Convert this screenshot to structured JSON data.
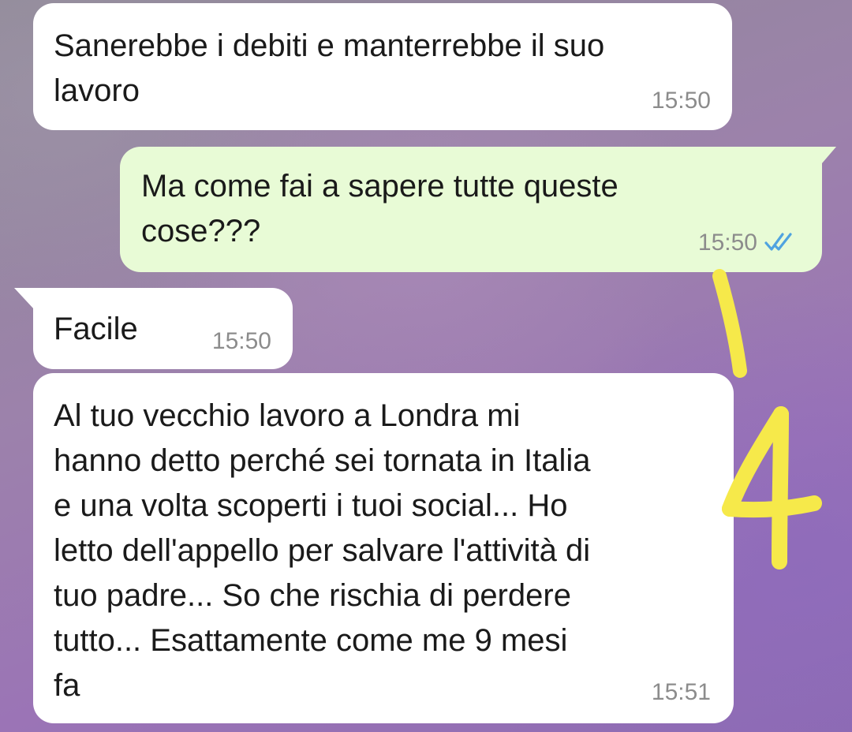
{
  "messages": [
    {
      "direction": "incoming",
      "text": "Sanerebbe i debiti e manterrebbe il suo\nlavoro",
      "time": "15:50"
    },
    {
      "direction": "outgoing",
      "text": "Ma come fai a sapere tutte queste\ncose???",
      "time": "15:50",
      "status_icon": "double-check-read-icon"
    },
    {
      "direction": "incoming",
      "text": "Facile",
      "time": "15:50"
    },
    {
      "direction": "incoming",
      "text": "Al tuo vecchio lavoro a Londra mi\nhanno detto perché sei tornata in Italia\ne una volta scoperti i tuoi social... Ho\nletto dell'appello per salvare l'attività di\ntuo padre... So che rischia di perdere\ntutto... Esattamente come me 9 mesi\nfa",
      "time": "15:51"
    }
  ],
  "annotation": {
    "icon": "handwritten-number-annotation",
    "color": "#f6e94a",
    "label": "4"
  },
  "colors": {
    "incoming_bubble": "#ffffff",
    "outgoing_bubble": "#e8fbd6",
    "timestamp": "#8c8c8c",
    "read_ticks": "#4fa3e0"
  }
}
